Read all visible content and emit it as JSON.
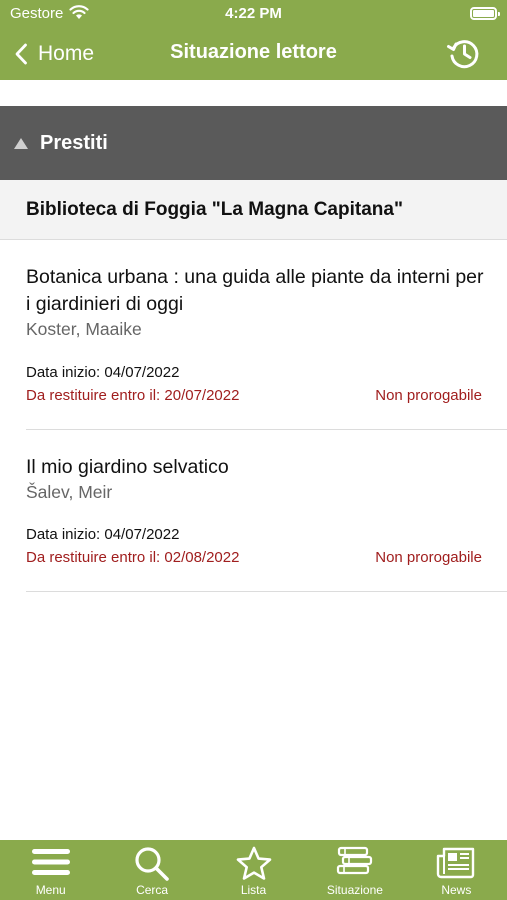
{
  "status_bar": {
    "carrier": "Gestore",
    "time": "4:22 PM"
  },
  "nav": {
    "back_label": "Home",
    "title": "Situazione lettore",
    "right_icon": "history-icon"
  },
  "section": {
    "title": "Prestiti",
    "expanded": true
  },
  "library": {
    "name": "Biblioteca di Foggia \"La Magna Capitana\""
  },
  "loans": [
    {
      "title": "Botanica urbana : una guida alle piante da interni per i giardinieri di oggi",
      "author": "Koster, Maaike",
      "start": "Data inizio: 04/07/2022",
      "due": "Da restituire entro il: 20/07/2022",
      "renewal": "Non prorogabile"
    },
    {
      "title": "Il mio giardino selvatico",
      "author": "Šalev, Meir",
      "start": "Data inizio: 04/07/2022",
      "due": "Da restituire entro il: 02/08/2022",
      "renewal": "Non prorogabile"
    }
  ],
  "tabs": [
    {
      "label": "Menu",
      "icon": "menu-icon"
    },
    {
      "label": "Cerca",
      "icon": "search-icon"
    },
    {
      "label": "Lista",
      "icon": "star-icon"
    },
    {
      "label": "Situazione",
      "icon": "books-icon"
    },
    {
      "label": "News",
      "icon": "newspaper-icon"
    }
  ],
  "colors": {
    "brand_green": "#8aaa4c",
    "section_header": "#5a5a5a",
    "due_red": "#a01e1e"
  }
}
